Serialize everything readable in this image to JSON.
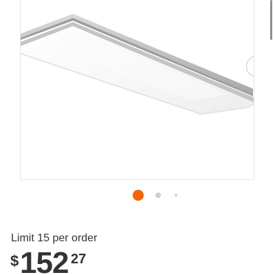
{
  "product_gallery": {
    "image_alt": "Flush mount LED panel light fixture",
    "image_count": 3,
    "active_index": 0,
    "next_icon": "chevron-right-icon",
    "active_dot_color": "#f96302",
    "inactive_dot_color": "#cfcfcf"
  },
  "purchase": {
    "limit_text": "Limit 15 per order",
    "price": {
      "currency": "$",
      "dollars": "152",
      "cents": "27"
    }
  },
  "colors": {
    "accent": "#f96302",
    "text": "#333333",
    "card_border": "#e5e5e5"
  }
}
